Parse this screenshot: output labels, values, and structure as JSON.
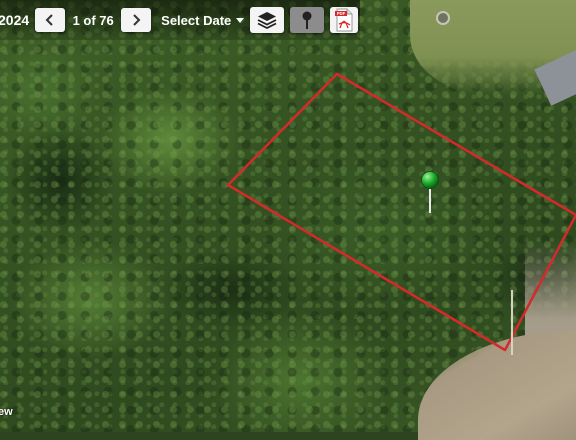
{
  "toolbar": {
    "year_label": "2024",
    "counter": "1 of 76",
    "select_date_label": "Select Date",
    "pdf_badge": "PDF"
  },
  "icons": {
    "prev": "chevron-left-icon",
    "next": "chevron-right-icon",
    "layers": "layers-icon",
    "pin_tool": "map-pin-icon",
    "pdf": "pdf-icon",
    "dropdown": "caret-down-icon"
  },
  "map": {
    "parcel_outline_color": "#d42a2a",
    "marker_color": "#1fae2c",
    "corner_label": "ew"
  }
}
